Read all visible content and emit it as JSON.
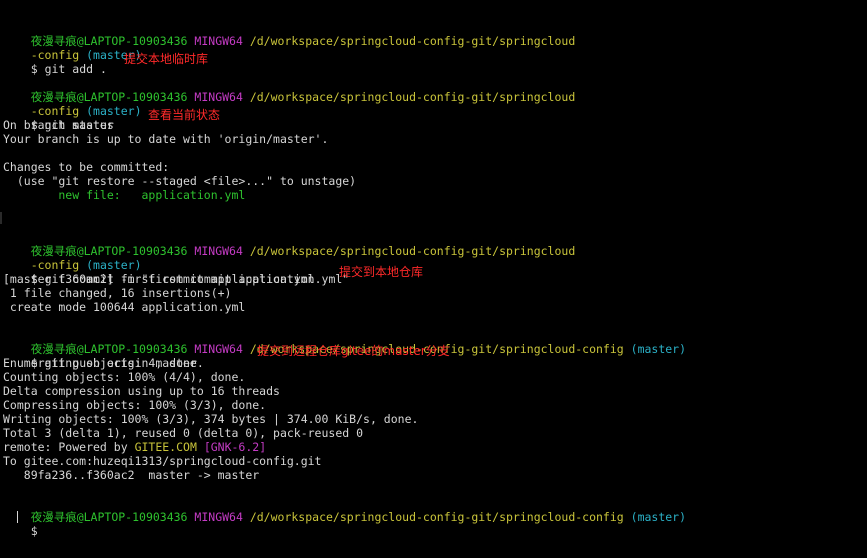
{
  "prompt": {
    "user_host": "夜漫寻痕@LAPTOP-10903436",
    "mingw": "MINGW64",
    "path_short_a": "/d/workspace/springcloud-config-git/springcloud",
    "path_short_b": "-config",
    "path_full": "/d/workspace/springcloud-config-git/springcloud-config",
    "branch": "(master)",
    "symbol": "$"
  },
  "block1": {
    "command": "git add .",
    "annotation": "提交本地临时库"
  },
  "block2": {
    "command": "git status",
    "annotation": "查看当前状态",
    "out1": "On branch master",
    "out2": "Your branch is up to date with 'origin/master'.",
    "out3": "Changes to be committed:",
    "out4": "  (use \"git restore --staged <file>...\" to unstage)",
    "new_file_label": "        new file:   application.yml"
  },
  "block3": {
    "command": "git commit -m \"first commit application.yml\"",
    "annotation": "提交到本地仓库",
    "out1": "[master f360ac2] first commit application.yml",
    "out2": " 1 file changed, 16 insertions(+)",
    "out3": " create mode 100644 application.yml"
  },
  "block4": {
    "command": "git push origin master",
    "annotation": "提交到远程仓库gitee的master分支",
    "out1": "Enumerating objects: 4, done.",
    "out2": "Counting objects: 100% (4/4), done.",
    "out3": "Delta compression using up to 16 threads",
    "out4": "Compressing objects: 100% (3/3), done.",
    "out5": "Writing objects: 100% (3/3), 374 bytes | 374.00 KiB/s, done.",
    "out6": "Total 3 (delta 1), reused 0 (delta 0), pack-reused 0",
    "remote_prefix": "remote: Powered by ",
    "remote_gitee": "GITEE.COM",
    "remote_gnk": "[GNK-6.2]",
    "out8": "To gitee.com:huzeqi1313/springcloud-config.git",
    "out9": "   89fa236..f360ac2  master -> master"
  },
  "colors": {
    "background": "#000000",
    "user_host": "#2ec22e",
    "mingw": "#c43bc4",
    "path": "#c9c43a",
    "branch": "#2bb0c6",
    "annotation": "#ff2a2a"
  }
}
